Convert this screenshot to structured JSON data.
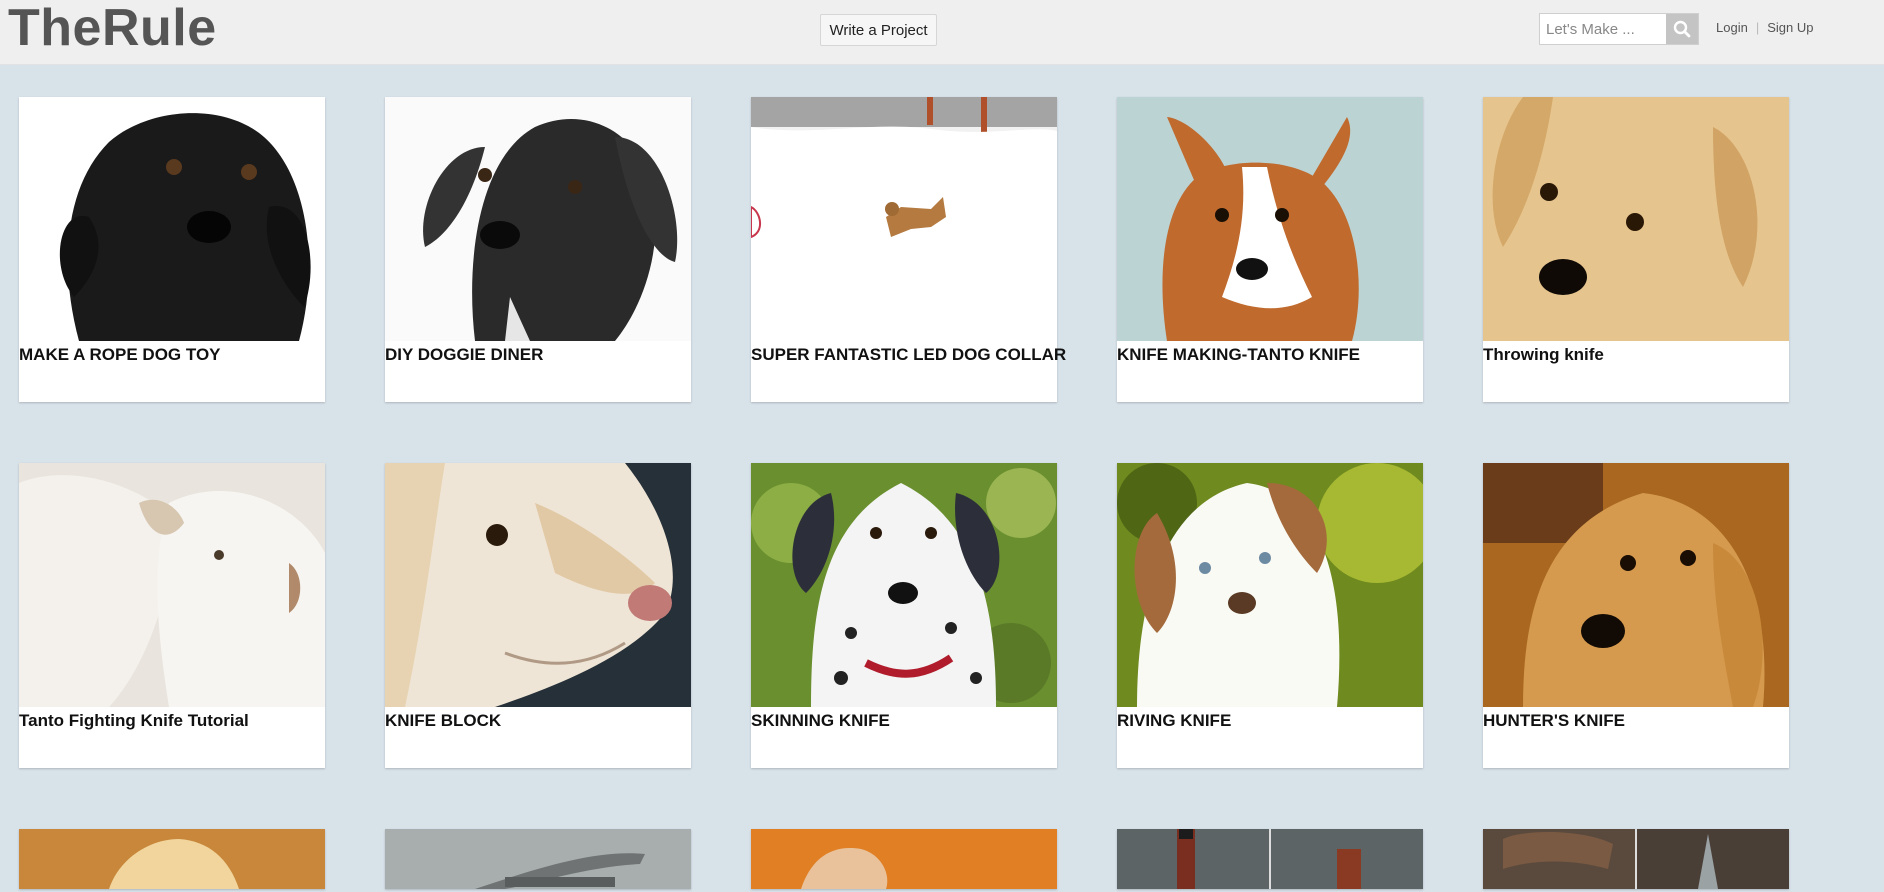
{
  "header": {
    "logo": "TheRule",
    "write_button": "Write a Project",
    "search_placeholder": "Let's Make ...",
    "login": "Login",
    "signup": "Sign Up"
  },
  "cards": [
    {
      "title": "MAKE A ROPE DOG TOY",
      "image": "black fluffy dog"
    },
    {
      "title": "DIY DOGGIE DINER",
      "image": "black floppy-ear dog"
    },
    {
      "title": "SUPER FANTASTIC LED DOG COLLAR",
      "image": "dog running in snow"
    },
    {
      "title": "KNIFE MAKING-TANTO KNIFE",
      "image": "corgi"
    },
    {
      "title": "Throwing knife",
      "image": "golden puppy"
    },
    {
      "title": "Tanto Fighting Knife Tutorial",
      "image": "white puppies"
    },
    {
      "title": "KNIFE BLOCK",
      "image": "white dog profile"
    },
    {
      "title": "SKINNING KNIFE",
      "image": "dalmatian"
    },
    {
      "title": "RIVING KNIFE",
      "image": "australian shepherd"
    },
    {
      "title": "HUNTER'S KNIFE",
      "image": "golden retriever"
    }
  ],
  "partial_cards": [
    {
      "image": "golden puppy"
    },
    {
      "image": "knife tool"
    },
    {
      "image": "hand on orange"
    },
    {
      "image": "knives on stone"
    },
    {
      "image": "leather knife"
    }
  ],
  "colors": {
    "background": "#d8e2e9",
    "header": "#efefef",
    "logo": "#555555"
  }
}
